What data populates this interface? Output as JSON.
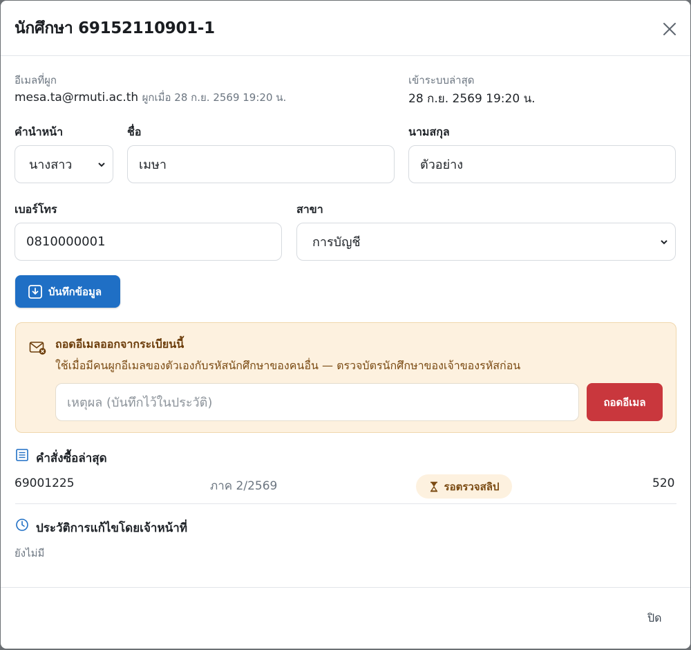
{
  "modal": {
    "title": "นักศึกษา 69152110901-1"
  },
  "email": {
    "label": "อีเมลที่ผูก",
    "value": "mesa.ta@rmuti.ac.th",
    "bound_note": "ผูกเมื่อ 28 ก.ย. 2569 19:20 น."
  },
  "last_login": {
    "label": "เข้าระบบล่าสุด",
    "value": "28 ก.ย. 2569 19:20 น."
  },
  "form": {
    "prefix_label": "คำนำหน้า",
    "prefix_value": "นางสาว",
    "first_name_label": "ชื่อ",
    "first_name_value": "เมษา",
    "last_name_label": "นามสกุล",
    "last_name_value": "ตัวอย่าง",
    "phone_label": "เบอร์โทร",
    "phone_value": "0810000001",
    "major_label": "สาขา",
    "major_value": "การบัญชี",
    "save_label": "บันทึกข้อมูล"
  },
  "unlink": {
    "title": "ถอดอีเมลออกจากระเบียนนี้",
    "description": "ใช้เมื่อมีคนผูกอีเมลของตัวเองกับรหัสนักศึกษาของคนอื่น — ตรวจบัตรนักศึกษาของเจ้าของรหัสก่อน",
    "reason_placeholder": "เหตุผล (บันทึกไว้ในประวัติ)",
    "button_label": "ถอดอีเมล"
  },
  "orders": {
    "title": "คำสั่งซื้อล่าสุด",
    "latest": {
      "order_id": "69001225",
      "term": "ภาค 2/2569",
      "status": "รอตรวจสลิป",
      "amount": "520"
    }
  },
  "history": {
    "title": "ประวัติการแก้ไขโดยเจ้าหน้าที่",
    "empty": "ยังไม่มี"
  },
  "footer": {
    "close_label": "ปิด"
  },
  "colors": {
    "primary": "#1f6fc5",
    "danger": "#c9373d",
    "warning_bg": "#fdf1df",
    "warning_text": "#7a4a12"
  },
  "icons": [
    "close-icon",
    "save-icon",
    "mail-remove-icon",
    "receipt-icon",
    "hourglass-icon",
    "clock-icon",
    "chevron-down-icon"
  ]
}
